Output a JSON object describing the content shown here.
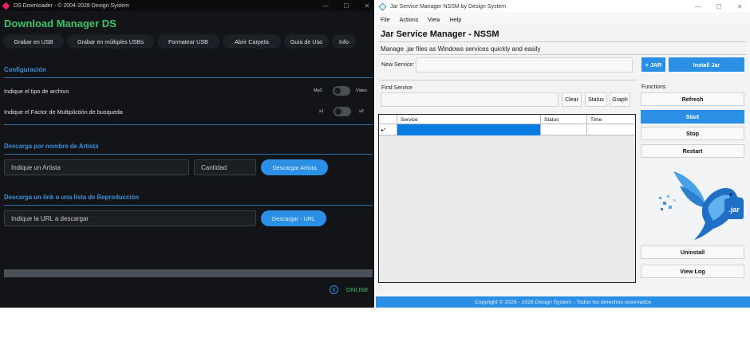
{
  "left_window": {
    "titlebar": {
      "title": "DS Downloader - © 2004-2028 Design System"
    },
    "brand": "Download Manager DS",
    "nav": [
      "Grabar en USB",
      "Grabar en múltiples USBs",
      "Formatear USB",
      "Abrir Carpeta",
      "Guía de Uso",
      "Info"
    ],
    "config": {
      "title": "Configuración",
      "file_type": {
        "label": "Indique el tipo de archivo",
        "off_label": "Mp3",
        "on_label": "Video",
        "checked": false
      },
      "factor": {
        "label": "Indique el Factor de Multiplictión de busqueda",
        "off_label": "x1",
        "on_label": "x2",
        "checked": false
      }
    },
    "artist": {
      "title": "Descarga por nombre de Artista",
      "artist_placeholder": "Indique un Artista",
      "quantity_placeholder": "Cantidad",
      "button": "Descargar Artista"
    },
    "link": {
      "title": "Descarga un link o una lista de Reproducción",
      "url_placeholder": "Indique la URL a descargar",
      "button": "Descargar - URL"
    },
    "progress": 0,
    "status": "ONLINE",
    "colors": {
      "background": "#121418",
      "accent": "#2b8fe6",
      "brand": "#39c46a"
    }
  },
  "right_window": {
    "titlebar": {
      "title": "Jar Service Manager NSSM by Design System"
    },
    "menu": [
      "File",
      "Actions",
      "View",
      "Help"
    ],
    "title": "Jar Service Manager - NSSM",
    "subtitle": "Manage .jar files as Windows services quickly and easily",
    "new_service_label": "New Service:",
    "add_jar_button": "+ JAR",
    "install_jar_button": "Install Jar",
    "find_service_label": "Find Service",
    "clear_button": "Clear",
    "status_button": "Status",
    "graph_button": "Graph",
    "grid": {
      "columns": [
        "Service",
        "Status",
        "Time"
      ],
      "rows": [
        {
          "indicator": "▸*",
          "service": "",
          "status": "",
          "time": ""
        }
      ]
    },
    "functions_label": "Functions",
    "functions": {
      "refresh": "Refresh",
      "start": "Start",
      "stop": "Stop",
      "restart": "Restart",
      "uninstall": "Uninstall",
      "view_log": "View Log"
    },
    "logo_text": ".jar",
    "footer": "Copyright © 2026 - 2028 Design System - Todos los derechos reservados",
    "colors": {
      "accent": "#2b8fe6",
      "selection": "#0a7be0"
    }
  }
}
